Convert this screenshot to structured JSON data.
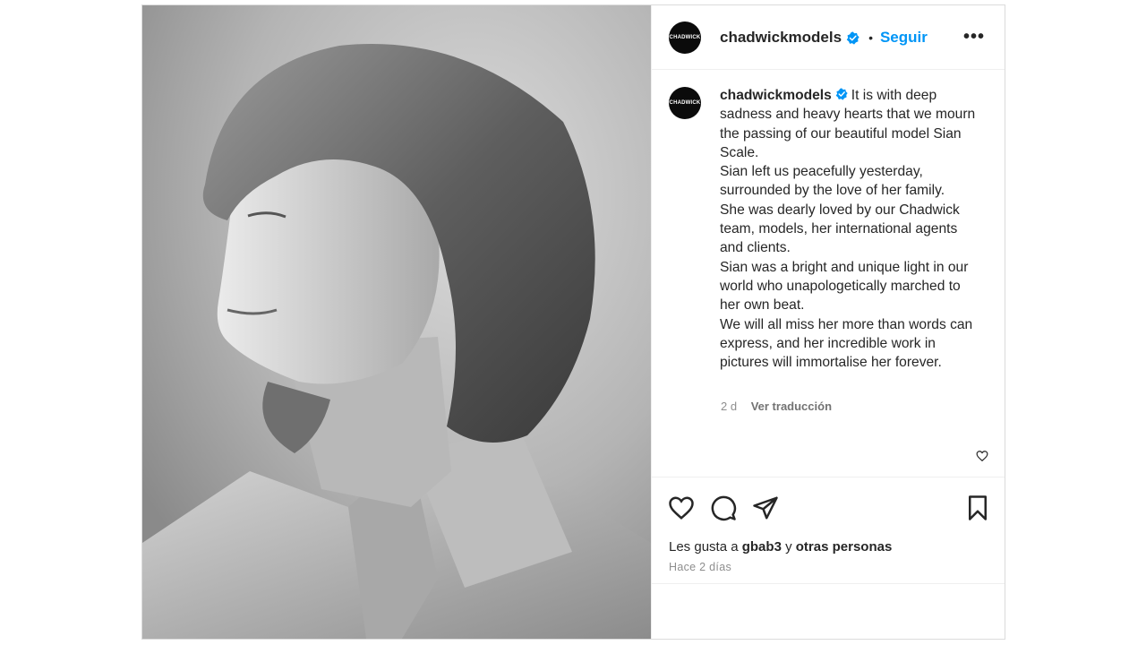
{
  "account": {
    "username": "chadwickmodels",
    "avatar_text": "CHADWICK",
    "verified_icon": "verified-badge-icon"
  },
  "header": {
    "separator": "•",
    "follow_label": "Seguir",
    "more_label": "•••"
  },
  "photo": {
    "description_icon": "portrait-photo"
  },
  "caption": {
    "username": "chadwickmodels",
    "text": "It is with deep sadness and heavy hearts that we mourn the passing of our beautiful model Sian Scale.\nSian left us peacefully yesterday, surrounded by the love of her family.\nShe was dearly loved by our Chadwick team, models, her international agents and clients.\nSian was a bright and unique light in our world who unapologetically marched to her own beat.\nWe will all miss her more than words can express, and her incredible work in pictures will immortalise her forever.",
    "age": "2 d",
    "translate_label": "Ver traducción"
  },
  "actions": {
    "like_icon": "heart-icon",
    "comment_icon": "comment-icon",
    "share_icon": "share-icon",
    "save_icon": "bookmark-icon"
  },
  "likes": {
    "prefix": "Les gusta a",
    "liker": "gbab3",
    "joiner": "y",
    "others": "otras personas"
  },
  "timestamp": "Hace 2 días",
  "colors": {
    "follow_blue": "#0095f6",
    "text": "#262626",
    "secondary": "#8e8e8e",
    "border": "#dbdbdb"
  }
}
